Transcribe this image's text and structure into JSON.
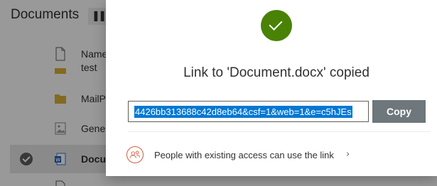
{
  "library": {
    "title": "Documents",
    "view_icon": "library-view-icon",
    "rows": [
      {
        "name": "test",
        "icon": "document-icon"
      },
      {
        "name": "MailP",
        "icon": "folder-icon"
      },
      {
        "name": "Gener",
        "icon": "image-icon"
      },
      {
        "name": "Docur",
        "icon": "word-icon",
        "selected": true
      }
    ],
    "header_name": "Name"
  },
  "dialog": {
    "status_icon": "success-check-icon",
    "title": "Link to 'Document.docx' copied",
    "link_value": "4426bb313688c42d8eb64&csf=1&web=1&e=c5hJEs",
    "copy_label": "Copy",
    "access_text": "People with existing access can use the link",
    "access_icon": "people-icon",
    "chevron": "›"
  },
  "colors": {
    "success": "#498205",
    "selection": "#0078d4",
    "copy_button": "#6e777b",
    "access_icon": "#d35b3c"
  }
}
